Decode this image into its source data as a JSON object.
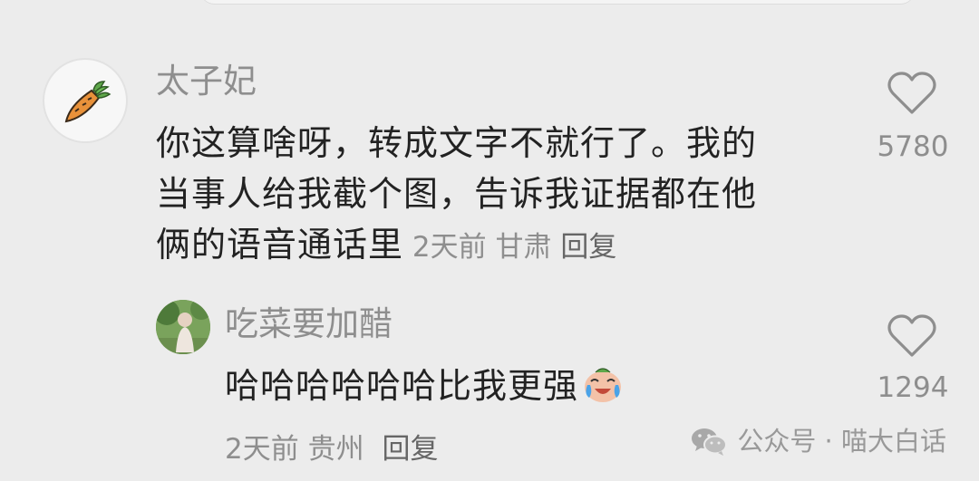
{
  "comments": [
    {
      "username": "太子妃",
      "text_line1": "你这算啥呀，转成文字不就行了。我的",
      "text_line2": "当事人给我截个图，告诉我证据都在他",
      "text_line3": "俩的语音通话里",
      "time": "2天前",
      "location": "甘肃",
      "reply_label": "回复",
      "likes": "5780",
      "avatar_icon": "carrot-icon"
    },
    {
      "username": "吃菜要加醋",
      "text": "哈哈哈哈哈哈比我更强",
      "emoji": "crying-laughing-emoji",
      "time": "2天前",
      "location": "贵州",
      "reply_label": "回复",
      "likes": "1294",
      "avatar_icon": "person-photo-avatar"
    }
  ],
  "watermark": {
    "icon": "wechat-icon",
    "text": "公众号 · 喵大白话"
  },
  "colors": {
    "background": "#ececec",
    "secondary_text": "#8e8e8e",
    "primary_text": "#222222"
  }
}
